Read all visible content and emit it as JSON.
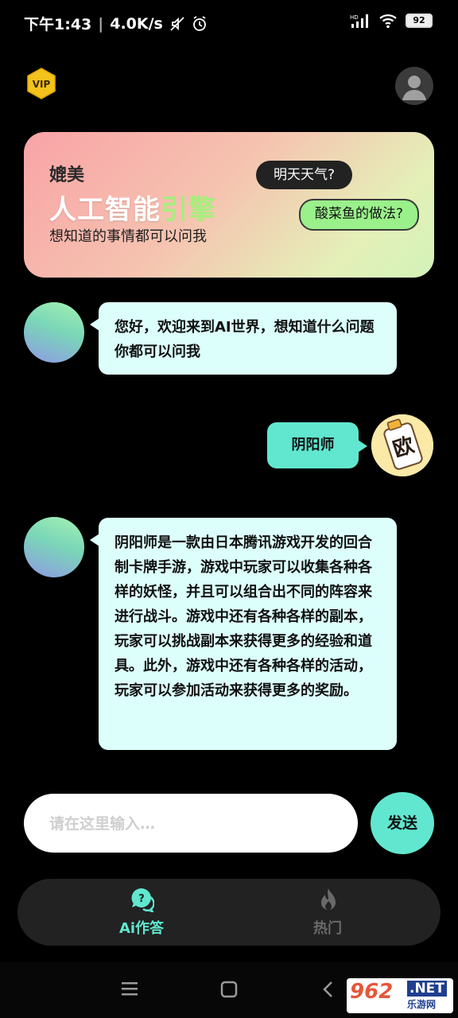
{
  "status_bar": {
    "time": "下午1:43",
    "speed": "4.0K/s",
    "battery": "92",
    "network_label": "HD"
  },
  "header": {
    "vip_label": "VIP"
  },
  "banner": {
    "app_name": "媲美",
    "title_part1": "人工智能",
    "title_part2": "引擎",
    "subtitle": "想知道的事情都可以问我",
    "suggestion_1": "明天天气?",
    "suggestion_2": "酸菜鱼的做法?"
  },
  "chat": {
    "messages": [
      {
        "role": "ai",
        "text": "您好，欢迎来到AI世界，想知道什么问题你都可以问我"
      },
      {
        "role": "user",
        "text": "阴阳师"
      },
      {
        "role": "ai",
        "text": "阴阳师是一款由日本腾讯游戏开发的回合制卡牌手游，游戏中玩家可以收集各种各样的妖怪，并且可以组合出不同的阵容来进行战斗。游戏中还有各种各样的副本，玩家可以挑战副本来获得更多的经验和道具。此外，游戏中还有各种各样的活动，玩家可以参加活动来获得更多的奖励。"
      }
    ],
    "user_avatar_text": "欧"
  },
  "input": {
    "placeholder": "请在这里输入…",
    "value": "",
    "send_label": "发送"
  },
  "tabs": [
    {
      "label": "Ai作答",
      "icon": "chat-question-icon",
      "active": true
    },
    {
      "label": "热门",
      "icon": "fire-icon",
      "active": false
    }
  ],
  "watermark": {
    "number": "962",
    "net": ".NET",
    "sub": "乐游网"
  },
  "colors": {
    "accent": "#61e7cf",
    "ai_bubble": "#dcfffb",
    "active_tab": "#61e7cf",
    "inactive_tab": "#6a6a6a"
  }
}
